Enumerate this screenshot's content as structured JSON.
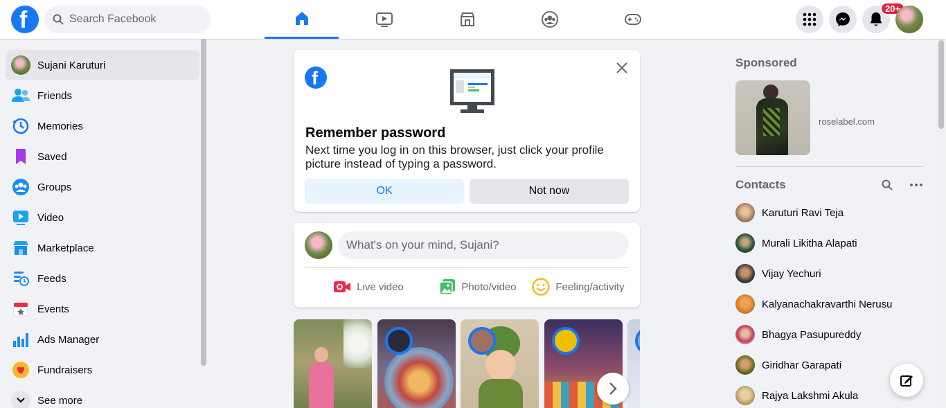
{
  "header": {
    "search_placeholder": "Search Facebook",
    "notification_count": "20+",
    "brand_color": "#1877f2",
    "nav_tabs": [
      {
        "icon": "home-icon",
        "active": true
      },
      {
        "icon": "watch-icon",
        "active": false
      },
      {
        "icon": "marketplace-icon",
        "active": false
      },
      {
        "icon": "groups-icon",
        "active": false
      },
      {
        "icon": "gaming-icon",
        "active": false
      }
    ]
  },
  "sidebar": {
    "items": [
      {
        "label": "Sujani Karuturi",
        "icon": "profile-avatar"
      },
      {
        "label": "Friends",
        "icon": "friends-icon"
      },
      {
        "label": "Memories",
        "icon": "memories-icon"
      },
      {
        "label": "Saved",
        "icon": "saved-icon"
      },
      {
        "label": "Groups",
        "icon": "groups-icon"
      },
      {
        "label": "Video",
        "icon": "video-icon"
      },
      {
        "label": "Marketplace",
        "icon": "marketplace-icon"
      },
      {
        "label": "Feeds",
        "icon": "feeds-icon"
      },
      {
        "label": "Events",
        "icon": "events-icon"
      },
      {
        "label": "Ads Manager",
        "icon": "ads-manager-icon"
      },
      {
        "label": "Fundraisers",
        "icon": "fundraisers-icon"
      },
      {
        "label": "See more",
        "icon": "chevron-down-icon"
      }
    ]
  },
  "password_prompt": {
    "title": "Remember password",
    "body": "Next time you log in on this browser, just click your profile picture instead of typing a password.",
    "ok_label": "OK",
    "not_now_label": "Not now"
  },
  "composer": {
    "placeholder": "What's on your mind, Sujani?",
    "actions": [
      {
        "label": "Live video",
        "icon": "live-video-icon",
        "color": "#f02849"
      },
      {
        "label": "Photo/video",
        "icon": "photo-video-icon",
        "color": "#45bd62"
      },
      {
        "label": "Feeling/activity",
        "icon": "feeling-icon",
        "color": "#f7b928"
      }
    ]
  },
  "right": {
    "sponsored_title": "Sponsored",
    "ad_domain": "roselabel.com",
    "contacts_title": "Contacts",
    "contacts": [
      "Karuturi Ravi Teja",
      "Murali Likitha Alapati",
      "Vijay Yechuri",
      "Kalyanachakravarthi Nerusu",
      "Bhagya Pasupureddy",
      "Giridhar Garapati",
      "Rajya Lakshmi Akula"
    ]
  }
}
